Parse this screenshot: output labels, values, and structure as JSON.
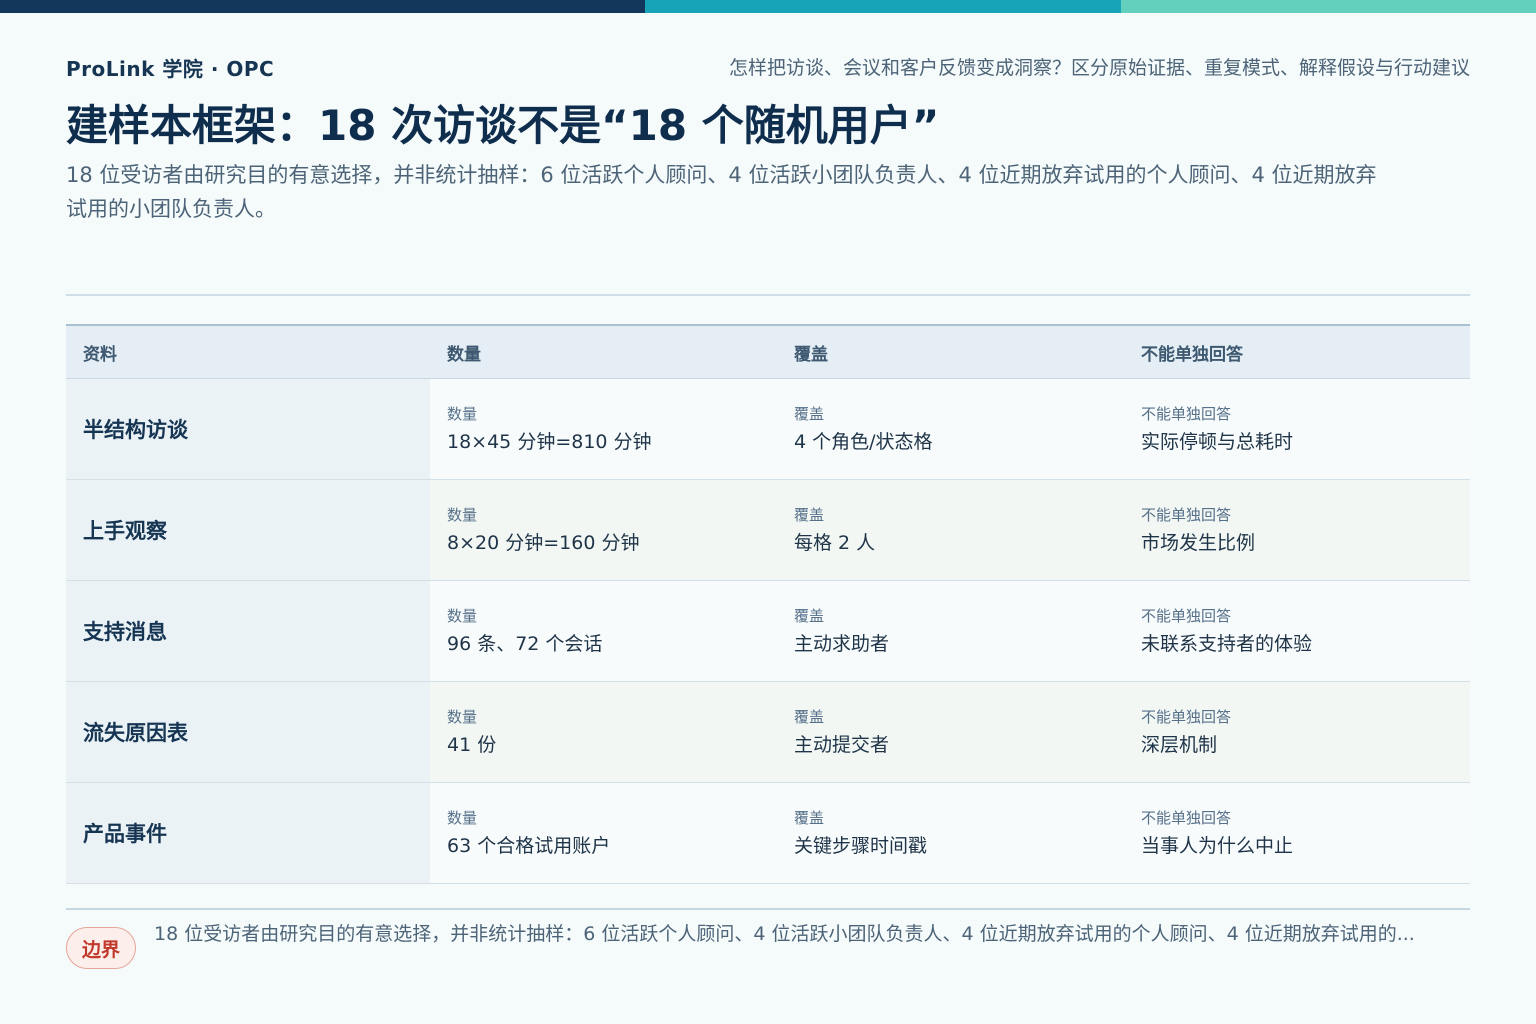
{
  "header": {
    "brand": "ProLink 学院 · OPC",
    "question": "怎样把访谈、会议和客户反馈变成洞察？区分原始证据、重复模式、解释假设与行动建议",
    "title": "建样本框架：18 次访谈不是“18 个随机用户”",
    "subtitle": "18 位受访者由研究目的有意选择，并非统计抽样：6 位活跃个人顾问、4 位活跃小团队负责人、4 位近期放弃试用的个人顾问、4 位近期放弃试用的小团队负责人。"
  },
  "colors": {
    "bar_navy": "#12375a",
    "bar_teal": "#17a3b8",
    "bar_mint": "#63d0bd",
    "badge_red": "#c0392b"
  },
  "table": {
    "columns": [
      "资料",
      "数量",
      "覆盖",
      "不能单独回答"
    ],
    "rows": [
      {
        "name": "半结构访谈",
        "qty_label": "数量",
        "qty": "18×45 分钟=810 分钟",
        "cov_label": "覆盖",
        "cov": "4 个角色/状态格",
        "lim_label": "不能单独回答",
        "lim": "实际停顿与总耗时"
      },
      {
        "name": "上手观察",
        "qty_label": "数量",
        "qty": "8×20 分钟=160 分钟",
        "cov_label": "覆盖",
        "cov": "每格 2 人",
        "lim_label": "不能单独回答",
        "lim": "市场发生比例"
      },
      {
        "name": "支持消息",
        "qty_label": "数量",
        "qty": "96 条、72 个会话",
        "cov_label": "覆盖",
        "cov": "主动求助者",
        "lim_label": "不能单独回答",
        "lim": "未联系支持者的体验"
      },
      {
        "name": "流失原因表",
        "qty_label": "数量",
        "qty": "41 份",
        "cov_label": "覆盖",
        "cov": "主动提交者",
        "lim_label": "不能单独回答",
        "lim": "深层机制"
      },
      {
        "name": "产品事件",
        "qty_label": "数量",
        "qty": "63 个合格试用账户",
        "cov_label": "覆盖",
        "cov": "关键步骤时间戳",
        "lim_label": "不能单独回答",
        "lim": "当事人为什么中止"
      }
    ]
  },
  "footer": {
    "badge": "边界",
    "text": "18 位受访者由研究目的有意选择，并非统计抽样：6 位活跃个人顾问、4 位活跃小团队负责人、4 位近期放弃试用的个人顾问、4 位近期放弃试用的..."
  }
}
